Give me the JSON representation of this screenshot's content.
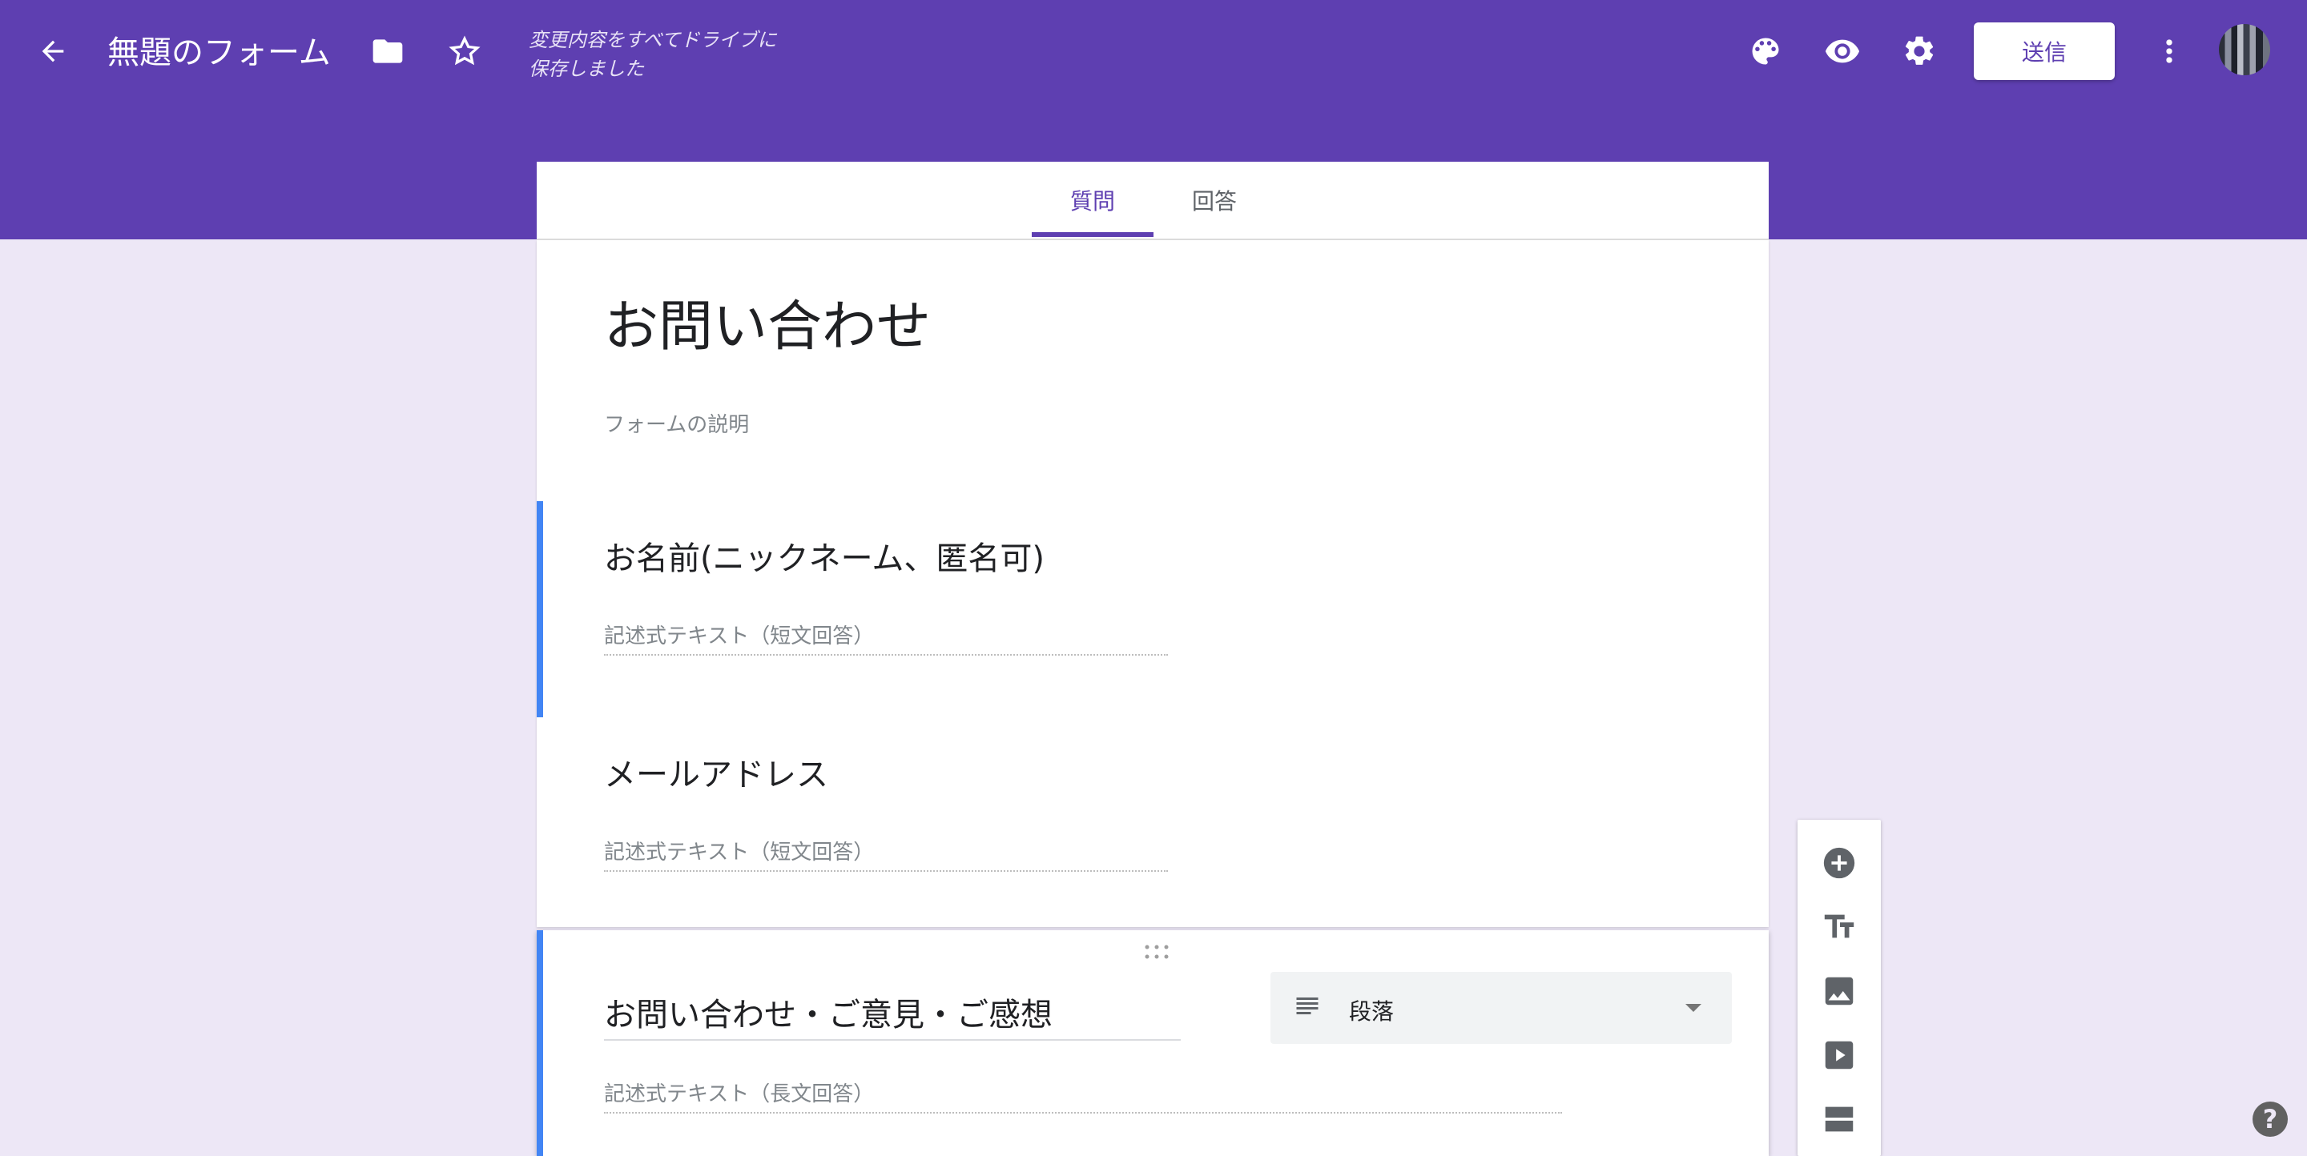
{
  "header": {
    "title": "無題のフォーム",
    "save_status_line1": "変更内容をすべてドライブに",
    "save_status_line2": "保存しました",
    "send_label": "送信"
  },
  "tabs": [
    {
      "label": "質問",
      "active": true
    },
    {
      "label": "回答",
      "active": false
    }
  ],
  "form": {
    "title": "お問い合わせ",
    "description_placeholder": "フォームの説明"
  },
  "questions": [
    {
      "title": "お名前(ニックネーム、匿名可)",
      "answer_placeholder": "記述式テキスト（短文回答）"
    },
    {
      "title": "メールアドレス",
      "answer_placeholder": "記述式テキスト（短文回答）"
    },
    {
      "title": "お問い合わせ・ご意見・ご感想",
      "answer_placeholder": "記述式テキスト（長文回答）",
      "type": "段落"
    }
  ],
  "colors": {
    "header": "#5e3fb1",
    "background": "#ede7f6",
    "accent": "#4285f4"
  },
  "help_label": "?"
}
